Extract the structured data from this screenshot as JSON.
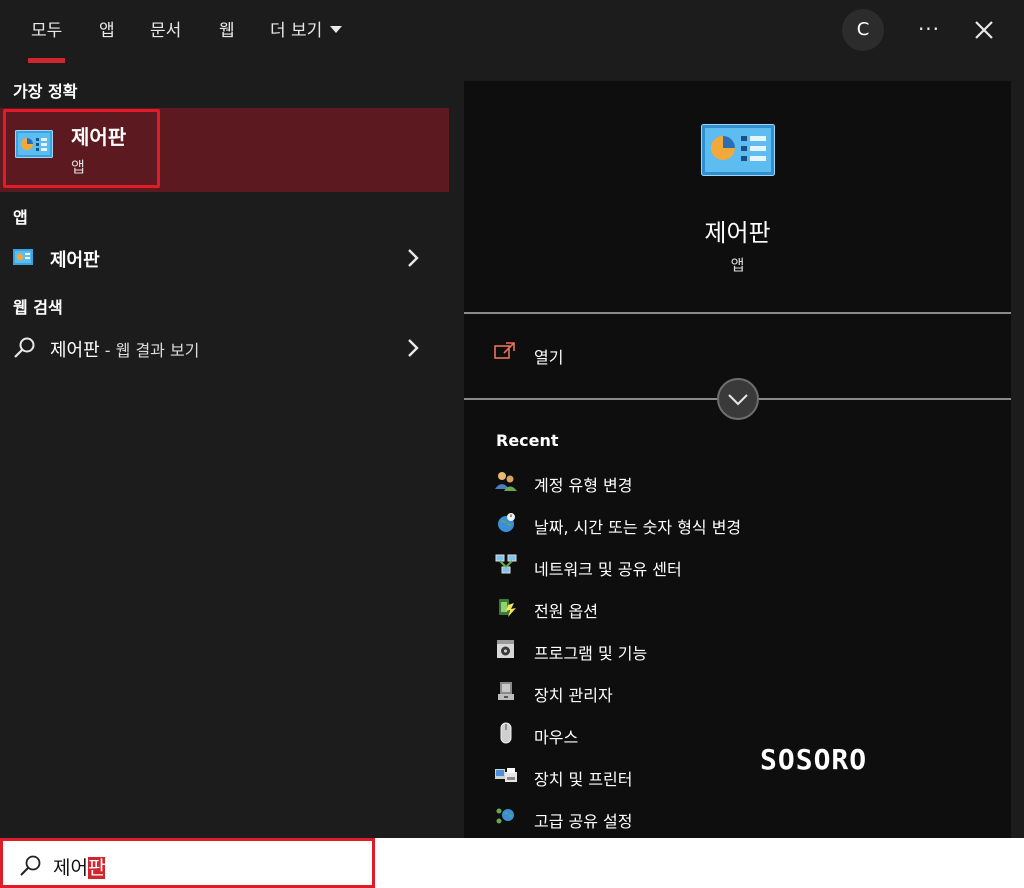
{
  "tabs": [
    {
      "label": "모두",
      "active": true
    },
    {
      "label": "앱",
      "active": false
    },
    {
      "label": "문서",
      "active": false
    },
    {
      "label": "웹",
      "active": false
    },
    {
      "label": "더 보기",
      "active": false
    }
  ],
  "header": {
    "avatar_initial": "C",
    "more_label": "···"
  },
  "left": {
    "best_match_heading": "가장 정확",
    "best_match": {
      "title": "제어판",
      "subtitle": "앱"
    },
    "apps_heading": "앱",
    "apps": [
      {
        "label": "제어판"
      }
    ],
    "web_heading": "웹 검색",
    "web": {
      "query": "제어판",
      "suffix": " - 웹 결과 보기"
    }
  },
  "right": {
    "title": "제어판",
    "subtitle": "앱",
    "open_label": "열기",
    "recent_heading": "Recent",
    "recent": [
      {
        "label": "계정 유형 변경",
        "icon": "users-icon"
      },
      {
        "label": "날짜, 시간 또는 숫자 형식 변경",
        "icon": "globe-clock-icon"
      },
      {
        "label": "네트워크 및 공유 센터",
        "icon": "network-icon"
      },
      {
        "label": "전원 옵션",
        "icon": "power-options-icon"
      },
      {
        "label": "프로그램 및 기능",
        "icon": "programs-icon"
      },
      {
        "label": "장치 관리자",
        "icon": "device-manager-icon"
      },
      {
        "label": "마우스",
        "icon": "mouse-icon"
      },
      {
        "label": "장치 및 프린터",
        "icon": "devices-printers-icon"
      },
      {
        "label": "고급 공유 설정",
        "icon": "sharing-settings-icon"
      }
    ],
    "watermark": "SOSORO"
  },
  "search": {
    "prefix": "제어",
    "typed": "판"
  },
  "colors": {
    "accent": "#d0262f",
    "highlight_bg": "#5c1a20",
    "outline": "#e01c29",
    "pane_bg": "#1c1c1c",
    "detail_bg": "#0e0e0e"
  }
}
